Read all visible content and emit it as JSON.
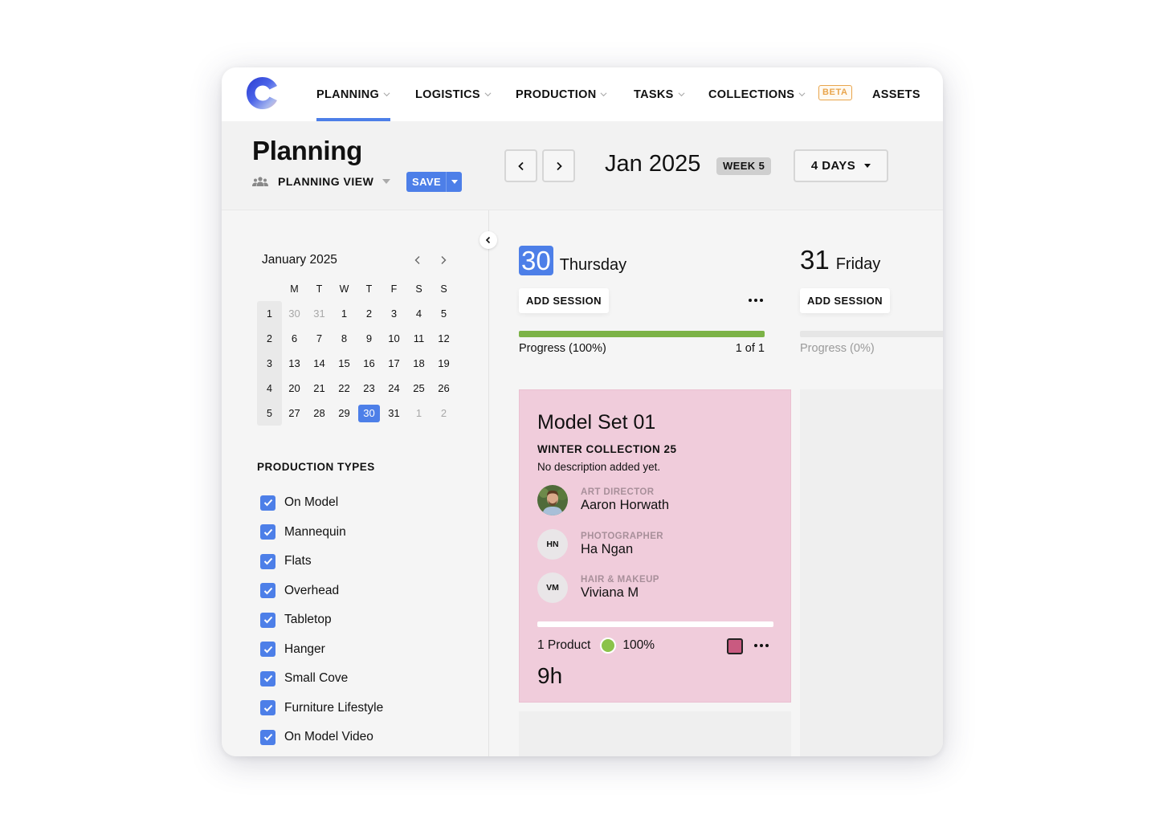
{
  "nav": {
    "items": [
      {
        "label": "PLANNING",
        "has_dropdown": true,
        "active": true
      },
      {
        "label": "LOGISTICS",
        "has_dropdown": true,
        "active": false
      },
      {
        "label": "PRODUCTION",
        "has_dropdown": true,
        "active": false
      },
      {
        "label": "TASKS",
        "has_dropdown": true,
        "active": false
      },
      {
        "label": "COLLECTIONS",
        "has_dropdown": true,
        "active": false
      },
      {
        "label": "ASSETS",
        "has_dropdown": false,
        "active": false
      }
    ],
    "beta_badge": "BETA",
    "accent_color": "#4d7fe8"
  },
  "header": {
    "title": "Planning",
    "view_icon": "team-icon",
    "view_label": "PLANNING VIEW",
    "save_label": "SAVE",
    "month_title": "Jan 2025",
    "week_badge": "WEEK 5",
    "range_label": "4 DAYS"
  },
  "mini_calendar": {
    "title": "January 2025",
    "weekdays": [
      "M",
      "T",
      "W",
      "T",
      "F",
      "S",
      "S"
    ],
    "weeks": [
      {
        "week": "1",
        "days": [
          "30",
          "31",
          "1",
          "2",
          "3",
          "4",
          "5"
        ]
      },
      {
        "week": "2",
        "days": [
          "6",
          "7",
          "8",
          "9",
          "10",
          "11",
          "12"
        ]
      },
      {
        "week": "3",
        "days": [
          "13",
          "14",
          "15",
          "16",
          "17",
          "18",
          "19"
        ]
      },
      {
        "week": "4",
        "days": [
          "20",
          "21",
          "22",
          "23",
          "24",
          "25",
          "26"
        ]
      },
      {
        "week": "5",
        "days": [
          "27",
          "28",
          "29",
          "30",
          "31",
          "1",
          "2"
        ]
      }
    ],
    "selected": "30"
  },
  "production_types": {
    "title": "PRODUCTION TYPES",
    "items": [
      {
        "label": "On Model",
        "checked": true
      },
      {
        "label": "Mannequin",
        "checked": true
      },
      {
        "label": "Flats",
        "checked": true
      },
      {
        "label": "Overhead",
        "checked": true
      },
      {
        "label": "Tabletop",
        "checked": true
      },
      {
        "label": "Hanger",
        "checked": true
      },
      {
        "label": "Small Cove",
        "checked": true
      },
      {
        "label": "Furniture Lifestyle",
        "checked": true
      },
      {
        "label": "On Model Video",
        "checked": true
      }
    ]
  },
  "days": [
    {
      "number": "30",
      "name": "Thursday",
      "today": true,
      "add_session_label": "ADD SESSION",
      "progress_label": "Progress (100%)",
      "progress_value": 1.0,
      "count_label": "1 of 1"
    },
    {
      "number": "31",
      "name": "Friday",
      "today": false,
      "add_session_label": "ADD SESSION",
      "progress_label": "Progress (0%)",
      "progress_value": 0.0
    }
  ],
  "session_card": {
    "title": "Model Set 01",
    "collection": "WINTER COLLECTION 25",
    "description": "No description added yet.",
    "crew": [
      {
        "role": "ART DIRECTOR",
        "name": "Aaron Horwath",
        "initials": "",
        "has_photo": true
      },
      {
        "role": "PHOTOGRAPHER",
        "name": "Ha Ngan",
        "initials": "HN",
        "has_photo": false
      },
      {
        "role": "HAIR & MAKEUP",
        "name": "Viviana M",
        "initials": "VM",
        "has_photo": false
      }
    ],
    "products_label": "1 Product",
    "product_progress": "100%",
    "hours": "9h",
    "card_color": "#f0ccdb",
    "swatch_color": "#c95a80"
  }
}
